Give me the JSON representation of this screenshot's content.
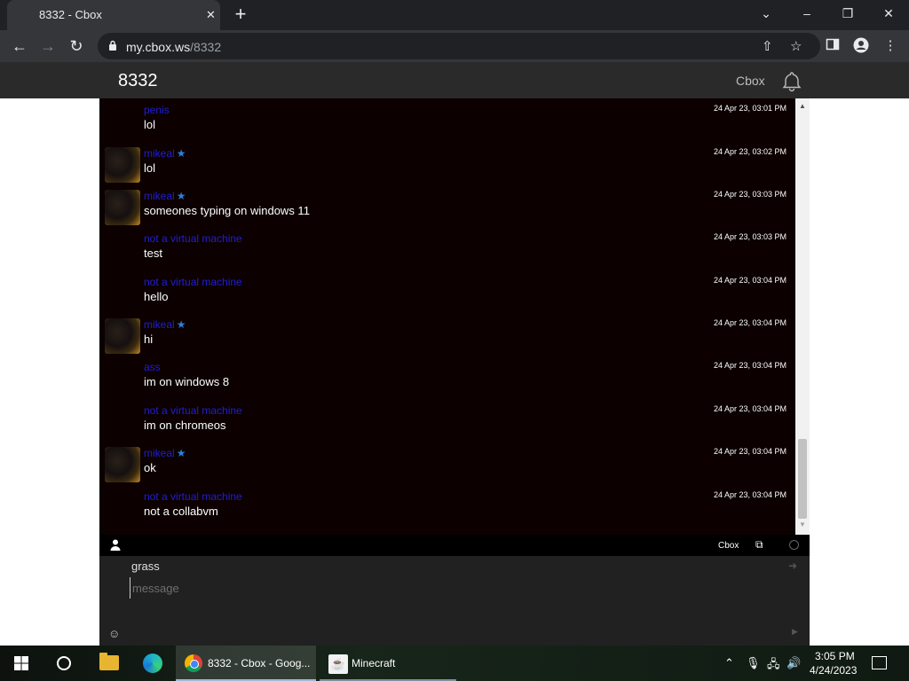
{
  "browser": {
    "tab_title": "8332 - Cbox",
    "tab_close": "✕",
    "new_tab": "+",
    "url_host": "my.cbox.ws",
    "url_path": "/8332",
    "window_controls": {
      "chevron": "⌄",
      "minimize": "–",
      "restore": "❐",
      "close": "✕"
    }
  },
  "site": {
    "title": "8332",
    "brand": "Cbox"
  },
  "messages": [
    {
      "author": "penis",
      "star": false,
      "avatar": false,
      "text": "lol",
      "time": "24 Apr 23, 03:01 PM"
    },
    {
      "author": "mikeal",
      "star": true,
      "avatar": true,
      "text": "lol",
      "time": "24 Apr 23, 03:02 PM"
    },
    {
      "author": "mikeal",
      "star": true,
      "avatar": true,
      "text": "someones typing on windows 11",
      "time": "24 Apr 23, 03:03 PM"
    },
    {
      "author": "not a virtual machine",
      "star": false,
      "avatar": false,
      "text": "test",
      "time": "24 Apr 23, 03:03 PM"
    },
    {
      "author": "not a virtual machine",
      "star": false,
      "avatar": false,
      "text": "hello",
      "time": "24 Apr 23, 03:04 PM"
    },
    {
      "author": "mikeal",
      "star": true,
      "avatar": true,
      "text": "hi",
      "time": "24 Apr 23, 03:04 PM"
    },
    {
      "author": "ass",
      "star": false,
      "avatar": false,
      "text": "im on windows 8",
      "time": "24 Apr 23, 03:04 PM"
    },
    {
      "author": "not a virtual machine",
      "star": false,
      "avatar": false,
      "text": "im on chromeos",
      "time": "24 Apr 23, 03:04 PM"
    },
    {
      "author": "mikeal",
      "star": true,
      "avatar": true,
      "text": "ok",
      "time": "24 Apr 23, 03:04 PM"
    },
    {
      "author": "not a virtual machine",
      "star": false,
      "avatar": false,
      "text": "not a collabvm",
      "time": "24 Apr 23, 03:04 PM"
    }
  ],
  "chat_bar": {
    "brand": "Cbox"
  },
  "compose": {
    "name": "grass",
    "placeholder": "message"
  },
  "taskbar": {
    "apps": [
      {
        "label": "8332 - Cbox - Goog...",
        "icon": "chrome-icon",
        "active": true
      },
      {
        "label": "Minecraft",
        "icon": "java-icon",
        "active": false
      }
    ],
    "clock_time": "3:05 PM",
    "clock_date": "4/24/2023"
  },
  "colors": {
    "chat_bg": "#0c0000",
    "author": "#1f1fd6",
    "star": "#2a7fe0",
    "header_bg": "#2a2a2a"
  }
}
